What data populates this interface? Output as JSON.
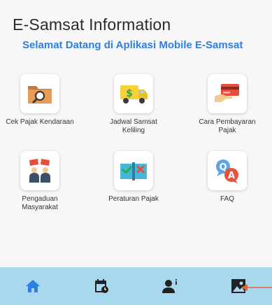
{
  "header": {
    "title": "E-Samsat Information",
    "welcome_marquee": "Selamat Datang di Aplikasi Mobile E-Samsat"
  },
  "menu": [
    {
      "label": "Cek Pajak Kendaraan",
      "icon": "folder-search-icon"
    },
    {
      "label": "Jadwal Samsat Keliling",
      "icon": "money-truck-icon"
    },
    {
      "label": "Cara Pembayaran Pajak",
      "icon": "card-payment-icon"
    },
    {
      "label": "Pengaduan Masyarakat",
      "icon": "complaint-people-icon"
    },
    {
      "label": "Peraturan Pajak",
      "icon": "regulation-book-icon"
    },
    {
      "label": "FAQ",
      "icon": "faq-bubbles-icon"
    }
  ],
  "bottom_nav": {
    "items": [
      {
        "name": "home",
        "icon": "home-icon",
        "active": true
      },
      {
        "name": "schedule",
        "icon": "calendar-clock-icon",
        "active": false
      },
      {
        "name": "profile",
        "icon": "user-info-icon",
        "active": false
      },
      {
        "name": "gallery",
        "icon": "image-gallery-icon",
        "active": false
      }
    ]
  },
  "colors": {
    "accent": "#2f7fe0",
    "nav_background": "#a8d8ee",
    "annotation_arrow": "#e8622a"
  }
}
